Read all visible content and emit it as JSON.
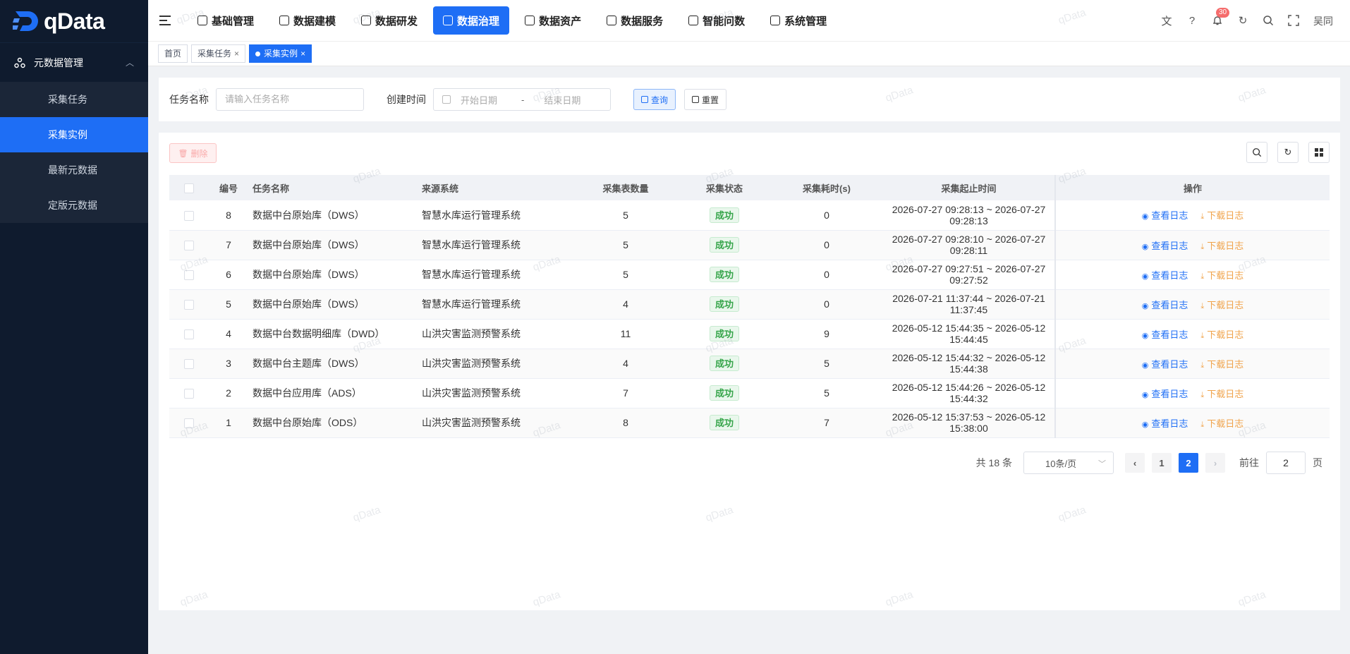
{
  "app": {
    "logo_text": "qData",
    "user_name": "吴同",
    "notification_count": "30",
    "watermark": "qData"
  },
  "top_nav": [
    {
      "label": "基础管理",
      "icon": "document-icon",
      "active": false
    },
    {
      "label": "数据建模",
      "icon": "cube-icon",
      "active": false
    },
    {
      "label": "数据研发",
      "icon": "hexagon-icon",
      "active": false
    },
    {
      "label": "数据治理",
      "icon": "shield-chart-icon",
      "active": true
    },
    {
      "label": "数据资产",
      "icon": "folder-icon",
      "active": false
    },
    {
      "label": "数据服务",
      "icon": "heart-icon",
      "active": false
    },
    {
      "label": "智能问数",
      "icon": "robot-icon",
      "active": false
    },
    {
      "label": "系统管理",
      "icon": "settings-icon",
      "active": false
    }
  ],
  "sidebar": {
    "group_label": "元数据管理",
    "items": [
      {
        "label": "采集任务",
        "active": false
      },
      {
        "label": "采集实例",
        "active": true
      },
      {
        "label": "最新元数据",
        "active": false
      },
      {
        "label": "定版元数据",
        "active": false
      }
    ]
  },
  "tabs": [
    {
      "label": "首页",
      "closable": false,
      "active": false
    },
    {
      "label": "采集任务",
      "closable": true,
      "active": false
    },
    {
      "label": "采集实例",
      "closable": true,
      "active": true
    }
  ],
  "search": {
    "task_name_label": "任务名称",
    "task_name_placeholder": "请输入任务名称",
    "created_time_label": "创建时间",
    "start_placeholder": "开始日期",
    "range_sep": "-",
    "end_placeholder": "结束日期",
    "query_label": "查询",
    "reset_label": "重置"
  },
  "toolbar": {
    "delete_label": "删除"
  },
  "table": {
    "columns": [
      "编号",
      "任务名称",
      "来源系统",
      "采集表数量",
      "采集状态",
      "采集耗时(s)",
      "采集起止时间",
      "操作"
    ],
    "rows": [
      {
        "id": "8",
        "task": "数据中台原始库（DWS）",
        "source": "智慧水库运行管理系统",
        "count": "5",
        "status": "成功",
        "duration": "0",
        "time": "2026-07-27 09:28:13 ~ 2026-07-27 09:28:13"
      },
      {
        "id": "7",
        "task": "数据中台原始库（DWS）",
        "source": "智慧水库运行管理系统",
        "count": "5",
        "status": "成功",
        "duration": "0",
        "time": "2026-07-27 09:28:10 ~ 2026-07-27 09:28:11"
      },
      {
        "id": "6",
        "task": "数据中台原始库（DWS）",
        "source": "智慧水库运行管理系统",
        "count": "5",
        "status": "成功",
        "duration": "0",
        "time": "2026-07-27 09:27:51 ~ 2026-07-27 09:27:52"
      },
      {
        "id": "5",
        "task": "数据中台原始库（DWS）",
        "source": "智慧水库运行管理系统",
        "count": "4",
        "status": "成功",
        "duration": "0",
        "time": "2026-07-21 11:37:44 ~ 2026-07-21 11:37:45"
      },
      {
        "id": "4",
        "task": "数据中台数据明细库（DWD）",
        "source": "山洪灾害监测预警系统",
        "count": "11",
        "status": "成功",
        "duration": "9",
        "time": "2026-05-12 15:44:35 ~ 2026-05-12 15:44:45"
      },
      {
        "id": "3",
        "task": "数据中台主题库（DWS）",
        "source": "山洪灾害监测预警系统",
        "count": "4",
        "status": "成功",
        "duration": "5",
        "time": "2026-05-12 15:44:32 ~ 2026-05-12 15:44:38"
      },
      {
        "id": "2",
        "task": "数据中台应用库（ADS）",
        "source": "山洪灾害监测预警系统",
        "count": "7",
        "status": "成功",
        "duration": "5",
        "time": "2026-05-12 15:44:26 ~ 2026-05-12 15:44:32"
      },
      {
        "id": "1",
        "task": "数据中台原始库（ODS）",
        "source": "山洪灾害监测预警系统",
        "count": "8",
        "status": "成功",
        "duration": "7",
        "time": "2026-05-12 15:37:53 ~ 2026-05-12 15:38:00"
      }
    ],
    "view_log_label": "查看日志",
    "download_log_label": "下载日志"
  },
  "pagination": {
    "total_text": "共 18 条",
    "page_size": "10条/页",
    "pages": [
      "1",
      "2"
    ],
    "current_page": "2",
    "goto_label": "前往",
    "goto_value": "2",
    "page_suffix": "页"
  },
  "colors": {
    "primary": "#1e6ef5",
    "sidebar_bg": "#0f1b2e",
    "success": "#36a54a",
    "warning": "#f0a34a"
  }
}
